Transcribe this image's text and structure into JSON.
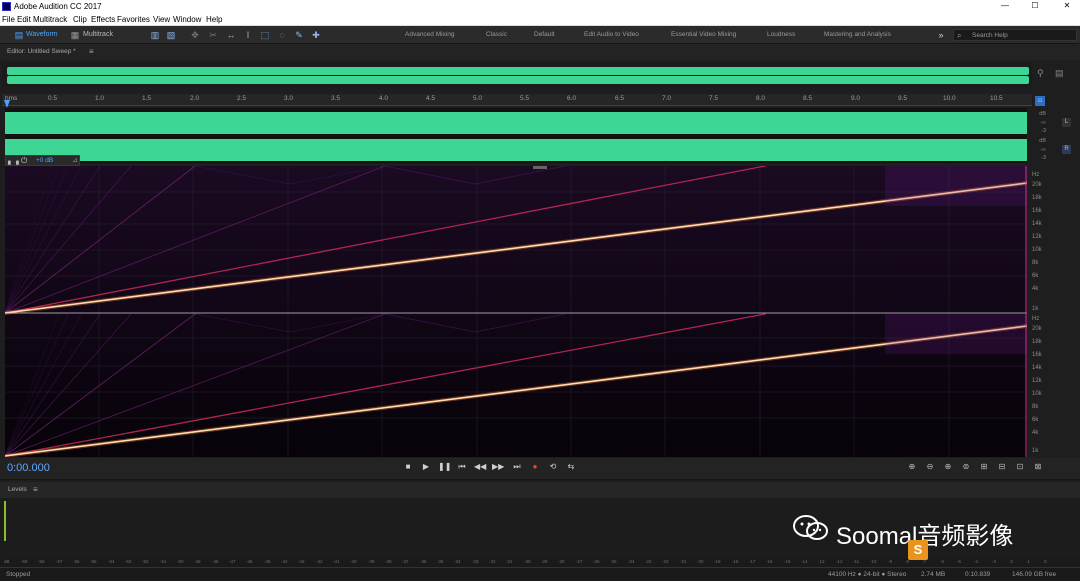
{
  "window": {
    "title": "Adobe Audition CC 2017"
  },
  "menu": [
    "File",
    "Edit",
    "Multitrack",
    "Clip",
    "Effects",
    "Favorites",
    "View",
    "Window",
    "Help"
  ],
  "toolbar": {
    "waveform_label": "Waveform",
    "multitrack_label": "Multitrack",
    "workspaces": [
      "Advanced Mixing",
      "Classic",
      "Default",
      "Edit Audio to Video",
      "Essential Video Mixing",
      "Loudness",
      "Mastering and Analysis"
    ],
    "search_placeholder": "Search Help"
  },
  "editor": {
    "tab_label": "Editor: Untitled Sweep *",
    "gain_label": "+0 dB"
  },
  "ruler": {
    "ticks": [
      "hms",
      "0.5",
      "1.0",
      "1.5",
      "2.0",
      "2.5",
      "3.0",
      "3.5",
      "4.0",
      "4.5",
      "5.0",
      "5.5",
      "6.0",
      "6.5",
      "7.0",
      "7.5",
      "8.0",
      "8.5",
      "9.0",
      "9.5",
      "10.0",
      "10.5"
    ]
  },
  "db_scale": [
    "dB",
    "-∞",
    "-3",
    "dB",
    "-∞",
    "-3"
  ],
  "channel_labels": {
    "left": "L",
    "right": "R"
  },
  "hz_scale": [
    "Hz",
    "20k",
    "18k",
    "16k",
    "14k",
    "12k",
    "10k",
    "8k",
    "6k",
    "4k",
    "2k",
    "1k"
  ],
  "transport": {
    "time": "0:00.000"
  },
  "levels": {
    "label": "Levels",
    "scale": [
      "dB",
      "-59",
      "-58",
      "-57",
      "-56",
      "-55",
      "-54",
      "-53",
      "-52",
      "-51",
      "-50",
      "-49",
      "-48",
      "-47",
      "-46",
      "-45",
      "-44",
      "-43",
      "-42",
      "-41",
      "-40",
      "-39",
      "-38",
      "-37",
      "-36",
      "-35",
      "-34",
      "-33",
      "-32",
      "-31",
      "-30",
      "-29",
      "-28",
      "-27",
      "-26",
      "-25",
      "-24",
      "-23",
      "-22",
      "-21",
      "-20",
      "-19",
      "-18",
      "-17",
      "-16",
      "-15",
      "-14",
      "-13",
      "-12",
      "-11",
      "-10",
      "-9",
      "-8",
      "-7",
      "-6",
      "-5",
      "-4",
      "-3",
      "-2",
      "-1",
      "0"
    ]
  },
  "status": {
    "state": "Stopped",
    "format": "44100 Hz ● 24-bit ● Stereo",
    "size": "2.74 MB",
    "duration": "0:10.839",
    "free": "146.09 GB free"
  },
  "watermark": {
    "text": "Soomal音频影像",
    "logo_letter": "S"
  },
  "colors": {
    "accent": "#4fa4ff",
    "waveform": "#3ed695",
    "record": "#ff3b3b",
    "sweep": "#ffe0b0"
  }
}
